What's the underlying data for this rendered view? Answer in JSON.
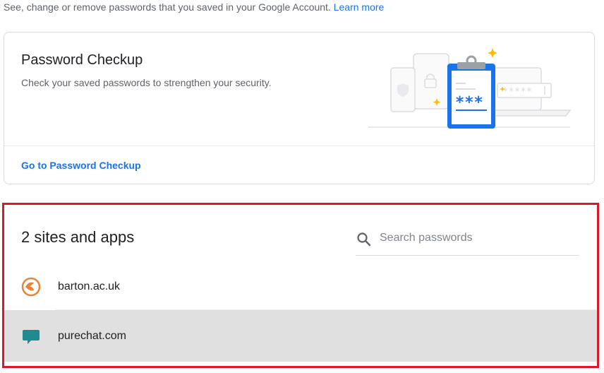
{
  "intro": {
    "text": "See, change or remove passwords that you saved in your Google Account.",
    "learn_more": "Learn more"
  },
  "checkup_card": {
    "title": "Password Checkup",
    "description": "Check your saved passwords to strengthen your security.",
    "link": "Go to Password Checkup",
    "illustration_stars": "***",
    "illustration_dots": "*****"
  },
  "sites": {
    "title": "2 sites and apps",
    "search_placeholder": "Search passwords",
    "items": [
      {
        "name": "barton.ac.uk",
        "icon": "barton-favicon"
      },
      {
        "name": "purechat.com",
        "icon": "purechat-favicon"
      }
    ]
  },
  "colors": {
    "accent": "#1a73e8",
    "highlight_border": "#d6192b",
    "selected_row": "#e0e0e0",
    "barton_icon": "#e8833a",
    "purechat_icon": "#1f8b8e"
  }
}
